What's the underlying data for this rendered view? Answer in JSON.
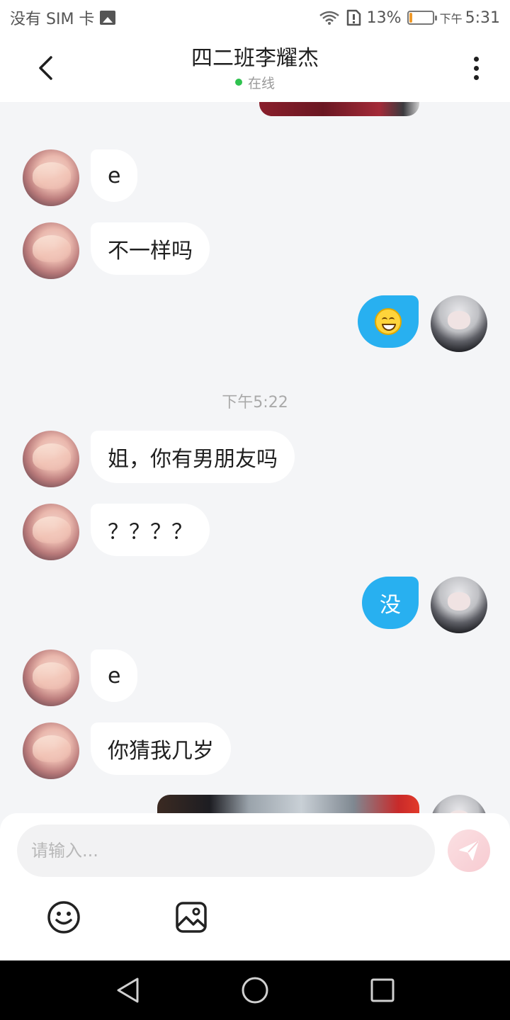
{
  "status_bar": {
    "carrier": "没有 SIM 卡",
    "battery": "13%",
    "battery_level": 0.13,
    "period": "下午",
    "time": "5:31"
  },
  "header": {
    "title": "四二班李耀杰",
    "online_status": "在线"
  },
  "chat": {
    "messages": [
      {
        "sender": "other",
        "type": "text",
        "text": "e"
      },
      {
        "sender": "other",
        "type": "text",
        "text": "不一样吗"
      },
      {
        "sender": "me",
        "type": "emoji",
        "icon": "grinning-face-icon"
      },
      {
        "sender": "other",
        "type": "text",
        "text": "姐，你有男朋友吗"
      },
      {
        "sender": "other",
        "type": "text",
        "text": "？？？？"
      },
      {
        "sender": "me",
        "type": "text",
        "text": "没"
      },
      {
        "sender": "other",
        "type": "text",
        "text": "e"
      },
      {
        "sender": "other",
        "type": "text",
        "text": "你猜我几岁"
      }
    ],
    "time_divider": "下午5:22"
  },
  "input": {
    "placeholder": "请输入..."
  },
  "colors": {
    "accent": "#28b0f0",
    "online": "#2fc24f",
    "send_button": "#f7cbd1"
  }
}
